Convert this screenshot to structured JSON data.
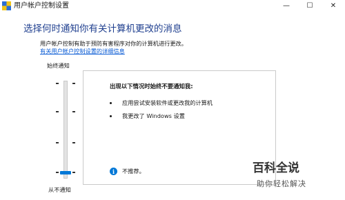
{
  "window": {
    "title": "用户帐户控制设置",
    "minimize_glyph": "—",
    "maximize_glyph": "☐",
    "close_glyph": "✕"
  },
  "main": {
    "heading": "选择何时通知你有关计算机更改的消息",
    "description": "用户帐户控制有助于预防有害程序对你的计算机进行更改。",
    "link": "有关用户帐户控制设置的详细信息"
  },
  "slider": {
    "top_label": "始终通知",
    "bottom_label": "从不通知",
    "level": 0
  },
  "info": {
    "title": "出现以下情况时始终不要通知我:",
    "items": [
      "应用尝试安装软件或更改我的计算机",
      "我更改了 Windows 设置"
    ],
    "recommendation_icon": "i",
    "recommendation": "不推荐。"
  },
  "watermark": {
    "title": "百科全说",
    "subtitle": "助你轻松解决"
  }
}
